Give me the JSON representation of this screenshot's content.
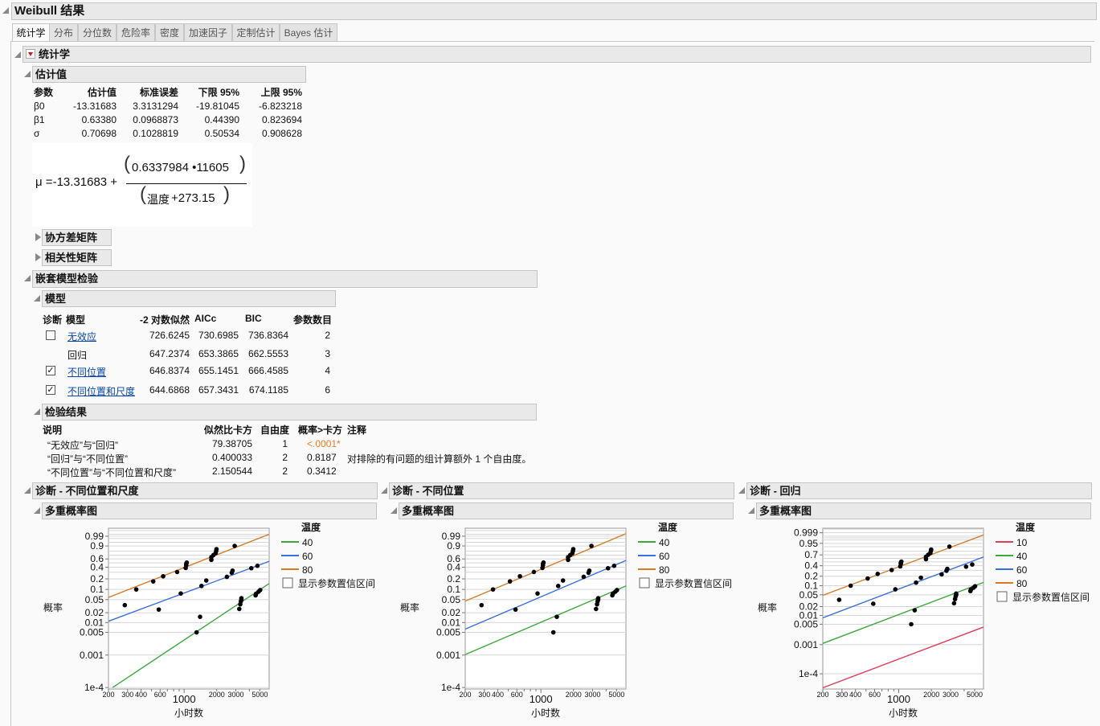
{
  "title": "Weibull 结果",
  "tabs": [
    "统计学",
    "分布",
    "分位数",
    "危险率",
    "密度",
    "加速因子",
    "定制估计",
    "Bayes 估计"
  ],
  "stats": {
    "title": "统计学",
    "estimates": {
      "title": "估计值",
      "columns": [
        "参数",
        "估计值",
        "标准误差",
        "下限 95%",
        "上限 95%"
      ],
      "rows": [
        [
          "β0",
          "-13.31683",
          "3.3131294",
          "-19.81045",
          "-6.823218"
        ],
        [
          "β1",
          "0.63380",
          "0.0968873",
          "0.44390",
          "0.823694"
        ],
        [
          "σ",
          "0.70698",
          "0.1028819",
          "0.50534",
          "0.908628"
        ]
      ]
    },
    "formula": {
      "lhs": "μ =-13.31683 +",
      "numerator": "0.6337984 •11605",
      "denominator_var": "温度",
      "denominator_rest": "+273.15"
    },
    "covariance": "协方差矩阵",
    "correlation": "相关性矩阵"
  },
  "nested": {
    "title": "嵌套模型检验",
    "models": {
      "title": "模型",
      "columns": [
        "诊断",
        "模型",
        "-2 对数似然",
        "AICc",
        "BIC",
        "参数数目"
      ],
      "rows": [
        {
          "checkbox": "unchecked",
          "name": "无效应",
          "link": true,
          "ll": "726.6245",
          "aicc": "730.6985",
          "bic": "736.8364",
          "n": "2"
        },
        {
          "checkbox": "none",
          "name": "回归",
          "link": false,
          "ll": "647.2374",
          "aicc": "653.3865",
          "bic": "662.5553",
          "n": "3"
        },
        {
          "checkbox": "checked",
          "name": "不同位置",
          "link": true,
          "ll": "646.8374",
          "aicc": "655.1451",
          "bic": "666.4585",
          "n": "4"
        },
        {
          "checkbox": "checked",
          "name": "不同位置和尺度",
          "link": true,
          "ll": "644.6868",
          "aicc": "657.3431",
          "bic": "674.1185",
          "n": "6"
        }
      ]
    },
    "tests": {
      "title": "检验结果",
      "columns": [
        "说明",
        "似然比卡方",
        "自由度",
        "概率>卡方",
        "注释"
      ],
      "rows": [
        {
          "desc": "“无效应”与“回归”",
          "chisq": "79.38705",
          "df": "1",
          "p": "<.0001*",
          "note": ""
        },
        {
          "desc": "“回归”与“不同位置”",
          "chisq": "0.400033",
          "df": "2",
          "p": "0.8187",
          "note": "对排除的有问题的组计算额外 1 个自由度。"
        },
        {
          "desc": "“不同位置”与“不同位置和尺度”",
          "chisq": "2.150544",
          "df": "2",
          "p": "0.3412",
          "note": ""
        }
      ],
      "significant_color": "#e87d1e"
    }
  },
  "colors": {
    "10": "#d9405a",
    "40": "#3aaa3a",
    "60": "#3b6fdc",
    "80": "#d77a23"
  },
  "chart_data": [
    {
      "section": "诊断 - 不同位置和尺度",
      "subtitle": "多重概率图",
      "type": "line",
      "x_scale": "log",
      "y_scale": "weibull-probability",
      "xlabel": "小时数",
      "ylabel": "概率",
      "xlim": [
        200,
        6100
      ],
      "ylim": [
        9e-05,
        0.9997
      ],
      "x_ticks": [
        "200",
        "300",
        "400",
        "600",
        "1000",
        "2000",
        "3000",
        "5000"
      ],
      "y_ticks": [
        "0.99",
        "0.9",
        "0.6",
        "0.4",
        "0.2",
        "0.1",
        "0.05",
        "0.02",
        "0.01",
        "0.005",
        "0.001",
        "1e-4"
      ],
      "grid": true,
      "legend": {
        "title": "温度",
        "placement": "right",
        "entries": [
          "40",
          "60",
          "80"
        ]
      },
      "checkbox": "显示参数置信区间",
      "series": [
        {
          "name": "40",
          "line": [
            [
              218,
              0.0001
            ],
            [
              6100,
              0.148
            ]
          ]
        },
        {
          "name": "60",
          "line": [
            [
              200,
              0.011
            ],
            [
              6100,
              0.54
            ]
          ]
        },
        {
          "name": "80",
          "line": [
            [
              200,
              0.058
            ],
            [
              6100,
              0.995
            ]
          ]
        }
      ]
    },
    {
      "section": "诊断 - 不同位置",
      "subtitle": "多重概率图",
      "type": "line",
      "x_scale": "log",
      "y_scale": "weibull-probability",
      "xlabel": "小时数",
      "ylabel": "概率",
      "xlim": [
        200,
        6100
      ],
      "ylim": [
        9e-05,
        0.9997
      ],
      "x_ticks": [
        "200",
        "300",
        "400",
        "600",
        "1000",
        "2000",
        "3000",
        "5000"
      ],
      "y_ticks": [
        "0.99",
        "0.9",
        "0.6",
        "0.4",
        "0.2",
        "0.1",
        "0.05",
        "0.02",
        "0.01",
        "0.005",
        "0.001",
        "1e-4"
      ],
      "grid": true,
      "legend": {
        "title": "温度",
        "placement": "right",
        "entries": [
          "40",
          "60",
          "80"
        ]
      },
      "checkbox": "显示参数置信区间",
      "series": [
        {
          "name": "40",
          "line": [
            [
              200,
              0.00104
            ],
            [
              6100,
              0.126
            ]
          ]
        },
        {
          "name": "60",
          "line": [
            [
              200,
              0.0063
            ],
            [
              6100,
              0.56
            ]
          ]
        },
        {
          "name": "80",
          "line": [
            [
              200,
              0.045
            ],
            [
              6100,
              0.996
            ]
          ]
        }
      ]
    },
    {
      "section": "诊断 - 回归",
      "subtitle": "多重概率图",
      "type": "line",
      "x_scale": "log",
      "y_scale": "weibull-probability",
      "xlabel": "小时数",
      "ylabel": "概率",
      "xlim": [
        200,
        6030
      ],
      "ylim": [
        3e-05,
        0.99995
      ],
      "x_ticks": [
        "200",
        "300",
        "400",
        "600",
        "1000",
        "2000",
        "3000",
        "5000"
      ],
      "y_ticks": [
        "0.999",
        "0.95",
        "0.7",
        "0.4",
        "0.2",
        "0.1",
        "0.05",
        "0.02",
        "0.01",
        "0.005",
        "0.001",
        "1e-4"
      ],
      "grid": true,
      "legend": {
        "title": "温度",
        "placement": "right",
        "entries": [
          "10",
          "40",
          "60",
          "80"
        ]
      },
      "checkbox": "显示参数置信区间",
      "series": [
        {
          "name": "10",
          "line": [
            [
              200,
              3.3e-05
            ],
            [
              6030,
              0.004
            ]
          ]
        },
        {
          "name": "40",
          "line": [
            [
              200,
              0.0011
            ],
            [
              6030,
              0.128
            ]
          ]
        },
        {
          "name": "60",
          "line": [
            [
              200,
              0.0083
            ],
            [
              6030,
              0.64
            ]
          ]
        },
        {
          "name": "80",
          "line": [
            [
              200,
              0.048
            ],
            [
              6030,
              0.997
            ]
          ]
        }
      ]
    }
  ],
  "points": [
    [
      283,
      0.034
    ],
    [
      361,
      0.1
    ],
    [
      518,
      0.17
    ],
    [
      640,
      0.235
    ],
    [
      861,
      0.305
    ],
    [
      1033,
      0.384
    ],
    [
      1045,
      0.443
    ],
    [
      1045,
      0.475
    ],
    [
      1057,
      0.508
    ],
    [
      1783,
      0.576
    ],
    [
      1783,
      0.646
    ],
    [
      1866,
      0.702
    ],
    [
      1954,
      0.749
    ],
    [
      1975,
      0.8
    ],
    [
      1990,
      0.841
    ],
    [
      2930,
      0.901
    ],
    [
      583,
      0.025
    ],
    [
      931,
      0.076
    ],
    [
      1445,
      0.126
    ],
    [
      1600,
      0.18
    ],
    [
      2483,
      0.227
    ],
    [
      2754,
      0.291
    ],
    [
      2800,
      0.33
    ],
    [
      4170,
      0.378
    ],
    [
      4750,
      0.431
    ],
    [
      1303,
      0.005
    ],
    [
      1403,
      0.015
    ],
    [
      3230,
      0.026
    ],
    [
      3300,
      0.036
    ],
    [
      3340,
      0.044
    ],
    [
      3380,
      0.05
    ],
    [
      3380,
      0.055
    ],
    [
      4570,
      0.067
    ],
    [
      4620,
      0.075
    ],
    [
      4870,
      0.086
    ],
    [
      5040,
      0.096
    ]
  ]
}
